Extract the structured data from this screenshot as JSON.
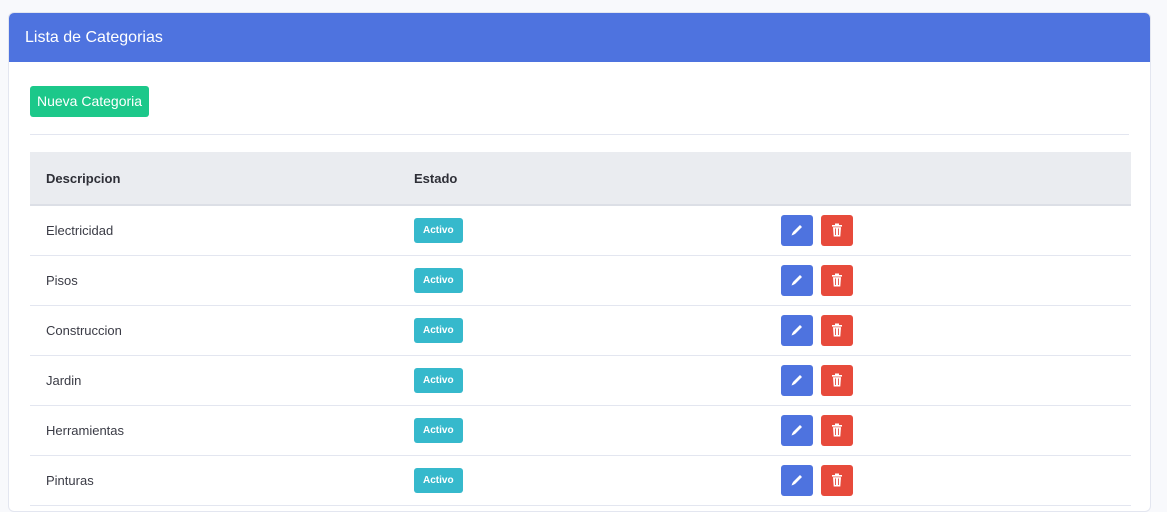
{
  "card": {
    "title": "Lista de Categorias"
  },
  "toolbar": {
    "new_label": "Nueva Categoria"
  },
  "table": {
    "headers": [
      "Descripcion",
      "Estado",
      ""
    ],
    "rows": [
      {
        "descripcion": "Electricidad",
        "estado": "Activo"
      },
      {
        "descripcion": "Pisos",
        "estado": "Activo"
      },
      {
        "descripcion": "Construccion",
        "estado": "Activo"
      },
      {
        "descripcion": "Jardin",
        "estado": "Activo"
      },
      {
        "descripcion": "Herramientas",
        "estado": "Activo"
      },
      {
        "descripcion": "Pinturas",
        "estado": "Activo"
      }
    ],
    "row_actions": [
      {
        "name": "edit-button",
        "icon": "pencil-icon",
        "color": "#4e73df"
      },
      {
        "name": "delete-button",
        "icon": "trash-icon",
        "color": "#e74a3b"
      }
    ]
  },
  "colors": {
    "header": "#4e73df",
    "new_button": "#1cc88a",
    "badge": "#36b9cc"
  }
}
